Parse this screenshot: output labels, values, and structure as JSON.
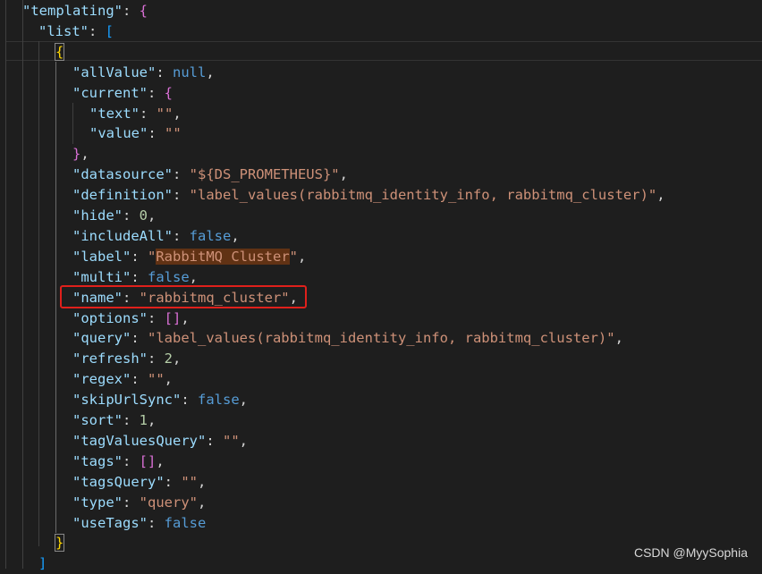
{
  "lines": [
    {
      "id": "templating",
      "indent": 1,
      "tokens": [
        {
          "t": "k",
          "v": "\"templating\""
        },
        {
          "t": "p",
          "v": ": "
        },
        {
          "t": "b2",
          "v": "{"
        }
      ]
    },
    {
      "id": "list",
      "indent": 2,
      "tokens": [
        {
          "t": "k",
          "v": "\"list\""
        },
        {
          "t": "p",
          "v": ": "
        },
        {
          "t": "b3",
          "v": "["
        }
      ]
    },
    {
      "id": "obj-open",
      "indent": 3,
      "tokens": [
        {
          "t": "b1",
          "v": "{",
          "m": true
        }
      ]
    },
    {
      "id": "allValue",
      "indent": 4,
      "tokens": [
        {
          "t": "k",
          "v": "\"allValue\""
        },
        {
          "t": "p",
          "v": ": "
        },
        {
          "t": "kw",
          "v": "null"
        },
        {
          "t": "p",
          "v": ","
        }
      ]
    },
    {
      "id": "current",
      "indent": 4,
      "tokens": [
        {
          "t": "k",
          "v": "\"current\""
        },
        {
          "t": "p",
          "v": ": "
        },
        {
          "t": "b2",
          "v": "{"
        }
      ]
    },
    {
      "id": "text",
      "indent": 5,
      "tokens": [
        {
          "t": "k",
          "v": "\"text\""
        },
        {
          "t": "p",
          "v": ": "
        },
        {
          "t": "s",
          "v": "\"\""
        },
        {
          "t": "p",
          "v": ","
        }
      ]
    },
    {
      "id": "value",
      "indent": 5,
      "tokens": [
        {
          "t": "k",
          "v": "\"value\""
        },
        {
          "t": "p",
          "v": ": "
        },
        {
          "t": "s",
          "v": "\"\""
        }
      ]
    },
    {
      "id": "current-close",
      "indent": 4,
      "tokens": [
        {
          "t": "b2",
          "v": "}"
        },
        {
          "t": "p",
          "v": ","
        }
      ]
    },
    {
      "id": "datasource",
      "indent": 4,
      "tokens": [
        {
          "t": "k",
          "v": "\"datasource\""
        },
        {
          "t": "p",
          "v": ": "
        },
        {
          "t": "s",
          "v": "\"${DS_PROMETHEUS}\""
        },
        {
          "t": "p",
          "v": ","
        }
      ]
    },
    {
      "id": "definition",
      "indent": 4,
      "tokens": [
        {
          "t": "k",
          "v": "\"definition\""
        },
        {
          "t": "p",
          "v": ": "
        },
        {
          "t": "s",
          "v": "\"label_values(rabbitmq_identity_info, rabbitmq_cluster)\""
        },
        {
          "t": "p",
          "v": ","
        }
      ]
    },
    {
      "id": "hide",
      "indent": 4,
      "tokens": [
        {
          "t": "k",
          "v": "\"hide\""
        },
        {
          "t": "p",
          "v": ": "
        },
        {
          "t": "n",
          "v": "0"
        },
        {
          "t": "p",
          "v": ","
        }
      ]
    },
    {
      "id": "includeAll",
      "indent": 4,
      "tokens": [
        {
          "t": "k",
          "v": "\"includeAll\""
        },
        {
          "t": "p",
          "v": ": "
        },
        {
          "t": "kw",
          "v": "false"
        },
        {
          "t": "p",
          "v": ","
        }
      ]
    },
    {
      "id": "label",
      "indent": 4,
      "tokens": [
        {
          "t": "k",
          "v": "\"label\""
        },
        {
          "t": "p",
          "v": ": "
        },
        {
          "t": "s",
          "v": "\""
        },
        {
          "t": "s",
          "v": "RabbitMQ Cluster",
          "sel": true
        },
        {
          "t": "s",
          "v": "\""
        },
        {
          "t": "p",
          "v": ","
        }
      ]
    },
    {
      "id": "multi",
      "indent": 4,
      "tokens": [
        {
          "t": "k",
          "v": "\"multi\""
        },
        {
          "t": "p",
          "v": ": "
        },
        {
          "t": "kw",
          "v": "false"
        },
        {
          "t": "p",
          "v": ","
        }
      ]
    },
    {
      "id": "name",
      "indent": 4,
      "tokens": [
        {
          "t": "k",
          "v": "\"name\""
        },
        {
          "t": "p",
          "v": ": "
        },
        {
          "t": "s",
          "v": "\"rabbitmq_cluster\""
        },
        {
          "t": "p",
          "v": ","
        }
      ]
    },
    {
      "id": "options",
      "indent": 4,
      "tokens": [
        {
          "t": "k",
          "v": "\"options\""
        },
        {
          "t": "p",
          "v": ": "
        },
        {
          "t": "b2",
          "v": "[]"
        },
        {
          "t": "p",
          "v": ","
        }
      ]
    },
    {
      "id": "query",
      "indent": 4,
      "tokens": [
        {
          "t": "k",
          "v": "\"query\""
        },
        {
          "t": "p",
          "v": ": "
        },
        {
          "t": "s",
          "v": "\"label_values(rabbitmq_identity_info, rabbitmq_cluster)\""
        },
        {
          "t": "p",
          "v": ","
        }
      ]
    },
    {
      "id": "refresh",
      "indent": 4,
      "tokens": [
        {
          "t": "k",
          "v": "\"refresh\""
        },
        {
          "t": "p",
          "v": ": "
        },
        {
          "t": "n",
          "v": "2"
        },
        {
          "t": "p",
          "v": ","
        }
      ]
    },
    {
      "id": "regex",
      "indent": 4,
      "tokens": [
        {
          "t": "k",
          "v": "\"regex\""
        },
        {
          "t": "p",
          "v": ": "
        },
        {
          "t": "s",
          "v": "\"\""
        },
        {
          "t": "p",
          "v": ","
        }
      ]
    },
    {
      "id": "skipUrlSync",
      "indent": 4,
      "tokens": [
        {
          "t": "k",
          "v": "\"skipUrlSync\""
        },
        {
          "t": "p",
          "v": ": "
        },
        {
          "t": "kw",
          "v": "false"
        },
        {
          "t": "p",
          "v": ","
        }
      ]
    },
    {
      "id": "sort",
      "indent": 4,
      "tokens": [
        {
          "t": "k",
          "v": "\"sort\""
        },
        {
          "t": "p",
          "v": ": "
        },
        {
          "t": "n",
          "v": "1"
        },
        {
          "t": "p",
          "v": ","
        }
      ]
    },
    {
      "id": "tagValuesQuery",
      "indent": 4,
      "tokens": [
        {
          "t": "k",
          "v": "\"tagValuesQuery\""
        },
        {
          "t": "p",
          "v": ": "
        },
        {
          "t": "s",
          "v": "\"\""
        },
        {
          "t": "p",
          "v": ","
        }
      ]
    },
    {
      "id": "tags",
      "indent": 4,
      "tokens": [
        {
          "t": "k",
          "v": "\"tags\""
        },
        {
          "t": "p",
          "v": ": "
        },
        {
          "t": "b2",
          "v": "[]"
        },
        {
          "t": "p",
          "v": ","
        }
      ]
    },
    {
      "id": "tagsQuery",
      "indent": 4,
      "tokens": [
        {
          "t": "k",
          "v": "\"tagsQuery\""
        },
        {
          "t": "p",
          "v": ": "
        },
        {
          "t": "s",
          "v": "\"\""
        },
        {
          "t": "p",
          "v": ","
        }
      ]
    },
    {
      "id": "type",
      "indent": 4,
      "tokens": [
        {
          "t": "k",
          "v": "\"type\""
        },
        {
          "t": "p",
          "v": ": "
        },
        {
          "t": "s",
          "v": "\"query\""
        },
        {
          "t": "p",
          "v": ","
        }
      ]
    },
    {
      "id": "useTags",
      "indent": 4,
      "tokens": [
        {
          "t": "k",
          "v": "\"useTags\""
        },
        {
          "t": "p",
          "v": ": "
        },
        {
          "t": "kw",
          "v": "false"
        }
      ]
    },
    {
      "id": "obj-close",
      "indent": 3,
      "tokens": [
        {
          "t": "b1",
          "v": "}",
          "m": true
        }
      ]
    },
    {
      "id": "list-close",
      "indent": 2,
      "tokens": [
        {
          "t": "b3",
          "v": "]"
        }
      ]
    }
  ],
  "watermark": "CSDN @MyySophia"
}
